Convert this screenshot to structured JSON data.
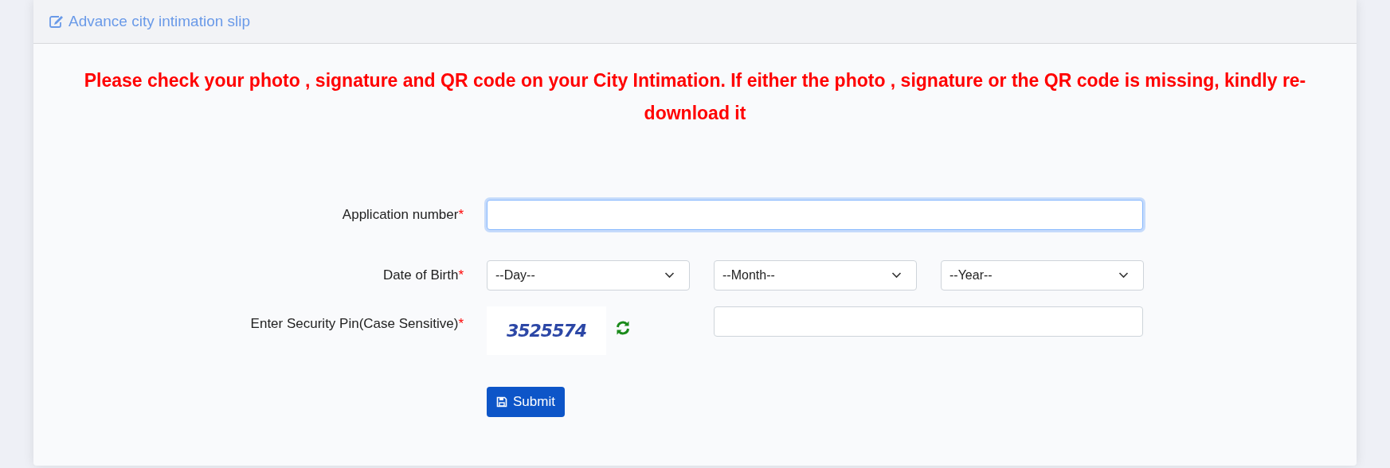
{
  "header": {
    "title": "Advance city intimation slip"
  },
  "notice": "Please check your photo , signature and QR code on your City Intimation. If either the photo , signature or the QR code is missing, kindly re-download it",
  "form": {
    "application_number": {
      "label": "Application number",
      "required_mark": "*",
      "focused": true
    },
    "date_of_birth": {
      "label": "Date of Birth",
      "required_mark": "*",
      "selects": [
        {
          "value": "--Day--"
        },
        {
          "value": "--Month--"
        },
        {
          "value": "--Year--"
        }
      ]
    },
    "security_pin": {
      "label": "Enter Security Pin(Case Sensitive)",
      "required_mark": "*",
      "captcha": "3525574"
    },
    "submit": {
      "label": "Submit"
    }
  }
}
